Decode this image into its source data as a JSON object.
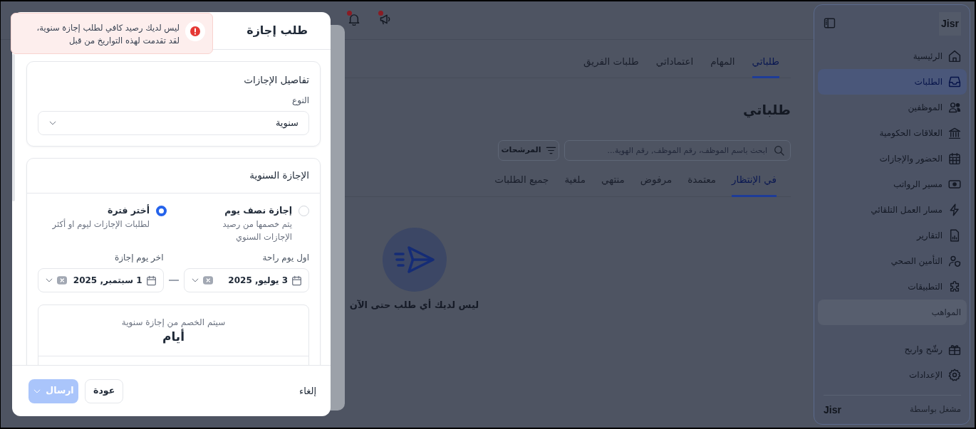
{
  "sidebar": {
    "logo": "Jisr",
    "items": [
      {
        "label": "الرئيسية",
        "selected": false,
        "disabled": false
      },
      {
        "label": "الطلبات",
        "selected": true,
        "disabled": false
      },
      {
        "label": "الموظفين",
        "selected": false,
        "disabled": false
      },
      {
        "label": "العلاقات الحكومية",
        "selected": false,
        "disabled": false
      },
      {
        "label": "الحضور والإجازات",
        "selected": false,
        "disabled": false
      },
      {
        "label": "مسير الرواتب",
        "selected": false,
        "disabled": false
      },
      {
        "label": "مسار العمل التلقائي",
        "selected": false,
        "disabled": false
      },
      {
        "label": "التقارير",
        "selected": false,
        "disabled": false
      },
      {
        "label": "التأمين الصحي",
        "selected": false,
        "disabled": false
      },
      {
        "label": "التطبيقات",
        "selected": false,
        "disabled": false
      },
      {
        "label": "المواهب",
        "selected": false,
        "disabled": true
      }
    ],
    "bottom_items": [
      {
        "label": "رشّح واربح"
      },
      {
        "label": "الإعدادات"
      }
    ],
    "footer": {
      "label": "مشغل بواسطة",
      "logo": "Jisr"
    }
  },
  "topbar": {
    "buttons": [
      {
        "unread": true
      },
      {
        "unread": true
      }
    ]
  },
  "page": {
    "tabs": [
      {
        "label": "طلباتي",
        "selected": true
      },
      {
        "label": "المهام",
        "selected": false
      },
      {
        "label": "اعتماداتي",
        "selected": false
      },
      {
        "label": "طلبات الفريق",
        "selected": false
      }
    ],
    "heading": "طلباتي",
    "search": {
      "placeholder": "ابحث باسم الموظف، رقم الموظف, رقم الهوية..."
    },
    "filter_button": "المرشحات",
    "status_tabs": [
      {
        "label": "في الإنتظار",
        "selected": true
      },
      {
        "label": "معتمدة",
        "selected": false
      },
      {
        "label": "مرفوض",
        "selected": false
      },
      {
        "label": "منتهي",
        "selected": false
      },
      {
        "label": "ملغية",
        "selected": false
      },
      {
        "label": "جميع الطلبات",
        "selected": false
      }
    ],
    "empty_state": {
      "message": "ليس لديك أي طلب حتى الآن"
    }
  },
  "modal": {
    "title": "طلب إجازة",
    "alert": {
      "message": "ليس لديك رصيد كافي لطلب إجازة سنوية، لقد تقدمت لهذه التواريخ من قبل"
    },
    "details_card": {
      "title": "تفاصيل الإجازات",
      "type_label": "النوع",
      "type_value": "سنوية"
    },
    "leave_card": {
      "title": "الإجازة السنوية",
      "options": [
        {
          "label": "إجازة نصف يوم",
          "description": "يتم خصمها من رصيد الإجازات السنوي",
          "selected": false
        },
        {
          "label": "أختر فترة",
          "description": "لطلبات الإجازات ليوم او أكثر",
          "selected": true
        }
      ],
      "start_date": {
        "label": "اول يوم راحة",
        "value": "3 يوليو, 2025"
      },
      "end_date": {
        "label": "اخر يوم إجازة",
        "value": "1 سبتمبر, 2025"
      },
      "deduction": {
        "note": "سيتم الخصم من إجازة سنوية",
        "unit": "أيام"
      }
    },
    "footer": {
      "cancel": "إلغاء",
      "back": "عودة",
      "submit": {
        "label": "ارسال",
        "disabled": true
      }
    }
  }
}
